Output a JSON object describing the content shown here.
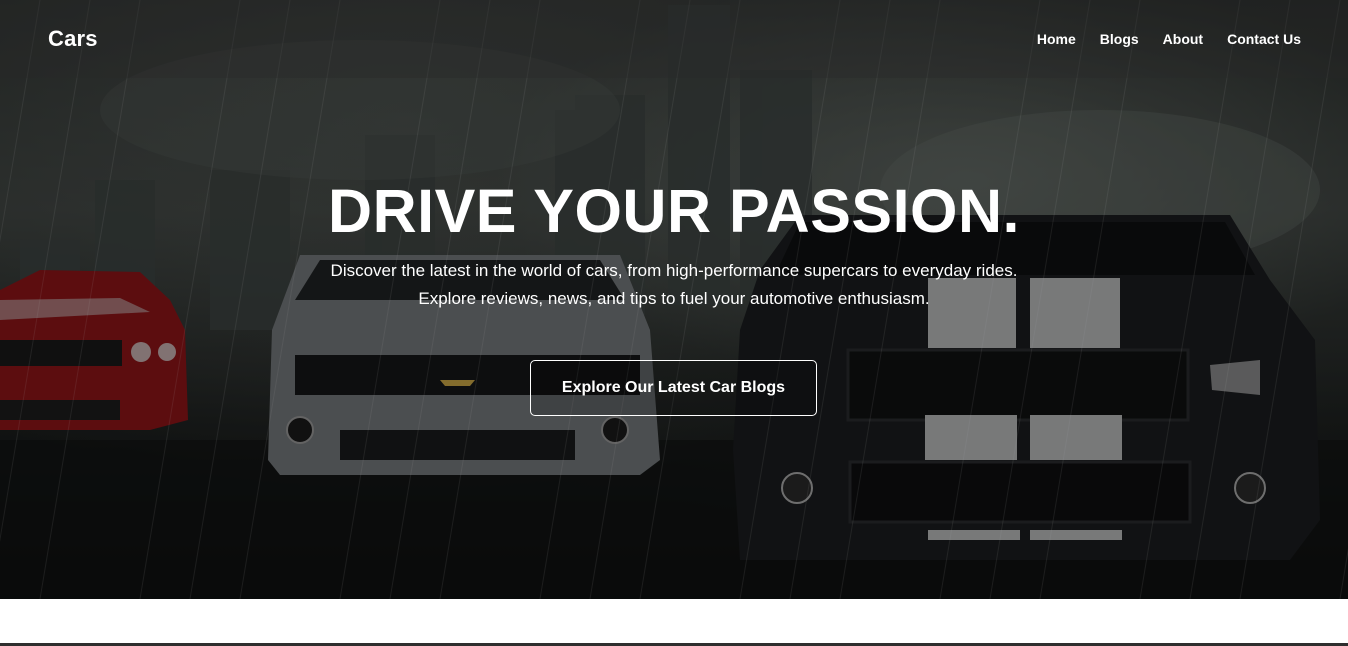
{
  "brand": "Cars",
  "nav": {
    "home": "Home",
    "blogs": "Blogs",
    "about": "About",
    "contact": "Contact Us"
  },
  "hero": {
    "headline": "DRIVE YOUR PASSION.",
    "subtext": "Discover the latest in the world of cars, from high-performance supercars to everyday rides. Explore reviews, news, and tips to fuel your automotive enthusiasm.",
    "cta": "Explore Our Latest Car Blogs"
  },
  "colors": {
    "overlay": "#1c1f1e",
    "text": "#ffffff",
    "car_red": "#b0141a",
    "car_silver": "#8d9092",
    "car_black": "#1b1d1f"
  }
}
